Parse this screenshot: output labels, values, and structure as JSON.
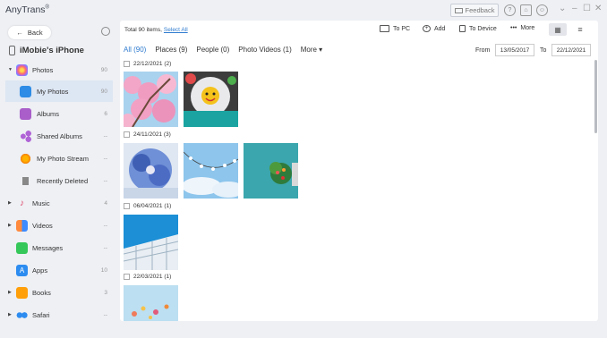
{
  "app": {
    "title": "AnyTrans",
    "reg": "®"
  },
  "titlebar": {
    "feedback_label": "Feedback"
  },
  "sidebar": {
    "back_label": "Back",
    "device_name": "iMobie's iPhone",
    "items": [
      {
        "label": "Photos",
        "count": "90"
      },
      {
        "label": "My Photos",
        "count": "90"
      },
      {
        "label": "Albums",
        "count": "6"
      },
      {
        "label": "Shared Albums",
        "count": "--"
      },
      {
        "label": "My Photo Stream",
        "count": "--"
      },
      {
        "label": "Recently Deleted",
        "count": "--"
      },
      {
        "label": "Music",
        "count": "4"
      },
      {
        "label": "Videos",
        "count": "--"
      },
      {
        "label": "Messages",
        "count": "--"
      },
      {
        "label": "Apps",
        "count": "10"
      },
      {
        "label": "Books",
        "count": "3"
      },
      {
        "label": "Safari",
        "count": "--"
      }
    ]
  },
  "toolbar": {
    "total_text": "Total 90 items,",
    "select_all": "Select All",
    "to_pc": "To PC",
    "add": "Add",
    "to_device": "To Device",
    "more": "More"
  },
  "tabs": [
    {
      "label": "All (90)",
      "active": true
    },
    {
      "label": "Places (9)"
    },
    {
      "label": "People (0)"
    },
    {
      "label": "Photo Videos (1)"
    },
    {
      "label": "More ▾"
    }
  ],
  "date_filter": {
    "from_label": "From",
    "from": "13/05/2017",
    "to_label": "To",
    "to": "22/12/2021"
  },
  "groups": [
    {
      "date": "22/12/2021 (2)"
    },
    {
      "date": "24/11/2021 (3)"
    },
    {
      "date": "06/04/2021 (1)"
    },
    {
      "date": "22/03/2021 (1)"
    }
  ],
  "colors": {
    "accent": "#2e7bcf",
    "active_bg": "#dde6f3"
  }
}
